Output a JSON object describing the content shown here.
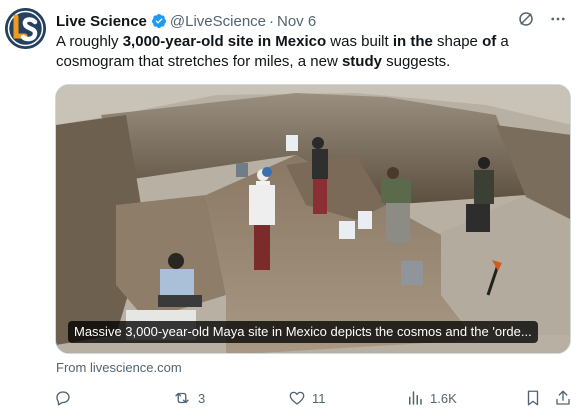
{
  "tweet": {
    "author_name": "Live Science",
    "handle": "@LiveScience",
    "separator": "·",
    "date": "Nov 6",
    "avatar_icon": "live-science-logo",
    "text_segments": [
      {
        "text": "A roughly ",
        "bold": false
      },
      {
        "text": "3,000-year-old site in Mexico",
        "bold": true
      },
      {
        "text": " was built ",
        "bold": false
      },
      {
        "text": "in the",
        "bold": true
      },
      {
        "text": " shape ",
        "bold": false
      },
      {
        "text": "of",
        "bold": true
      },
      {
        "text": " a cosmogram that stretches for miles, a new ",
        "bold": false
      },
      {
        "text": "study",
        "bold": true
      },
      {
        "text": " suggests.",
        "bold": false
      }
    ],
    "media": {
      "caption": "Massive 3,000-year-old Maya site in Mexico depicts the cosmos and the 'orde..."
    },
    "link_source": "From livescience.com",
    "stats": {
      "replies": "",
      "retweets": "3",
      "likes": "11",
      "views": "1.6K"
    }
  },
  "colors": {
    "text_primary": "#0f1419",
    "text_secondary": "#536471",
    "verified_blue": "#1d9bf0",
    "logo_blue": "#24415f",
    "logo_orange": "#f29a1f"
  }
}
